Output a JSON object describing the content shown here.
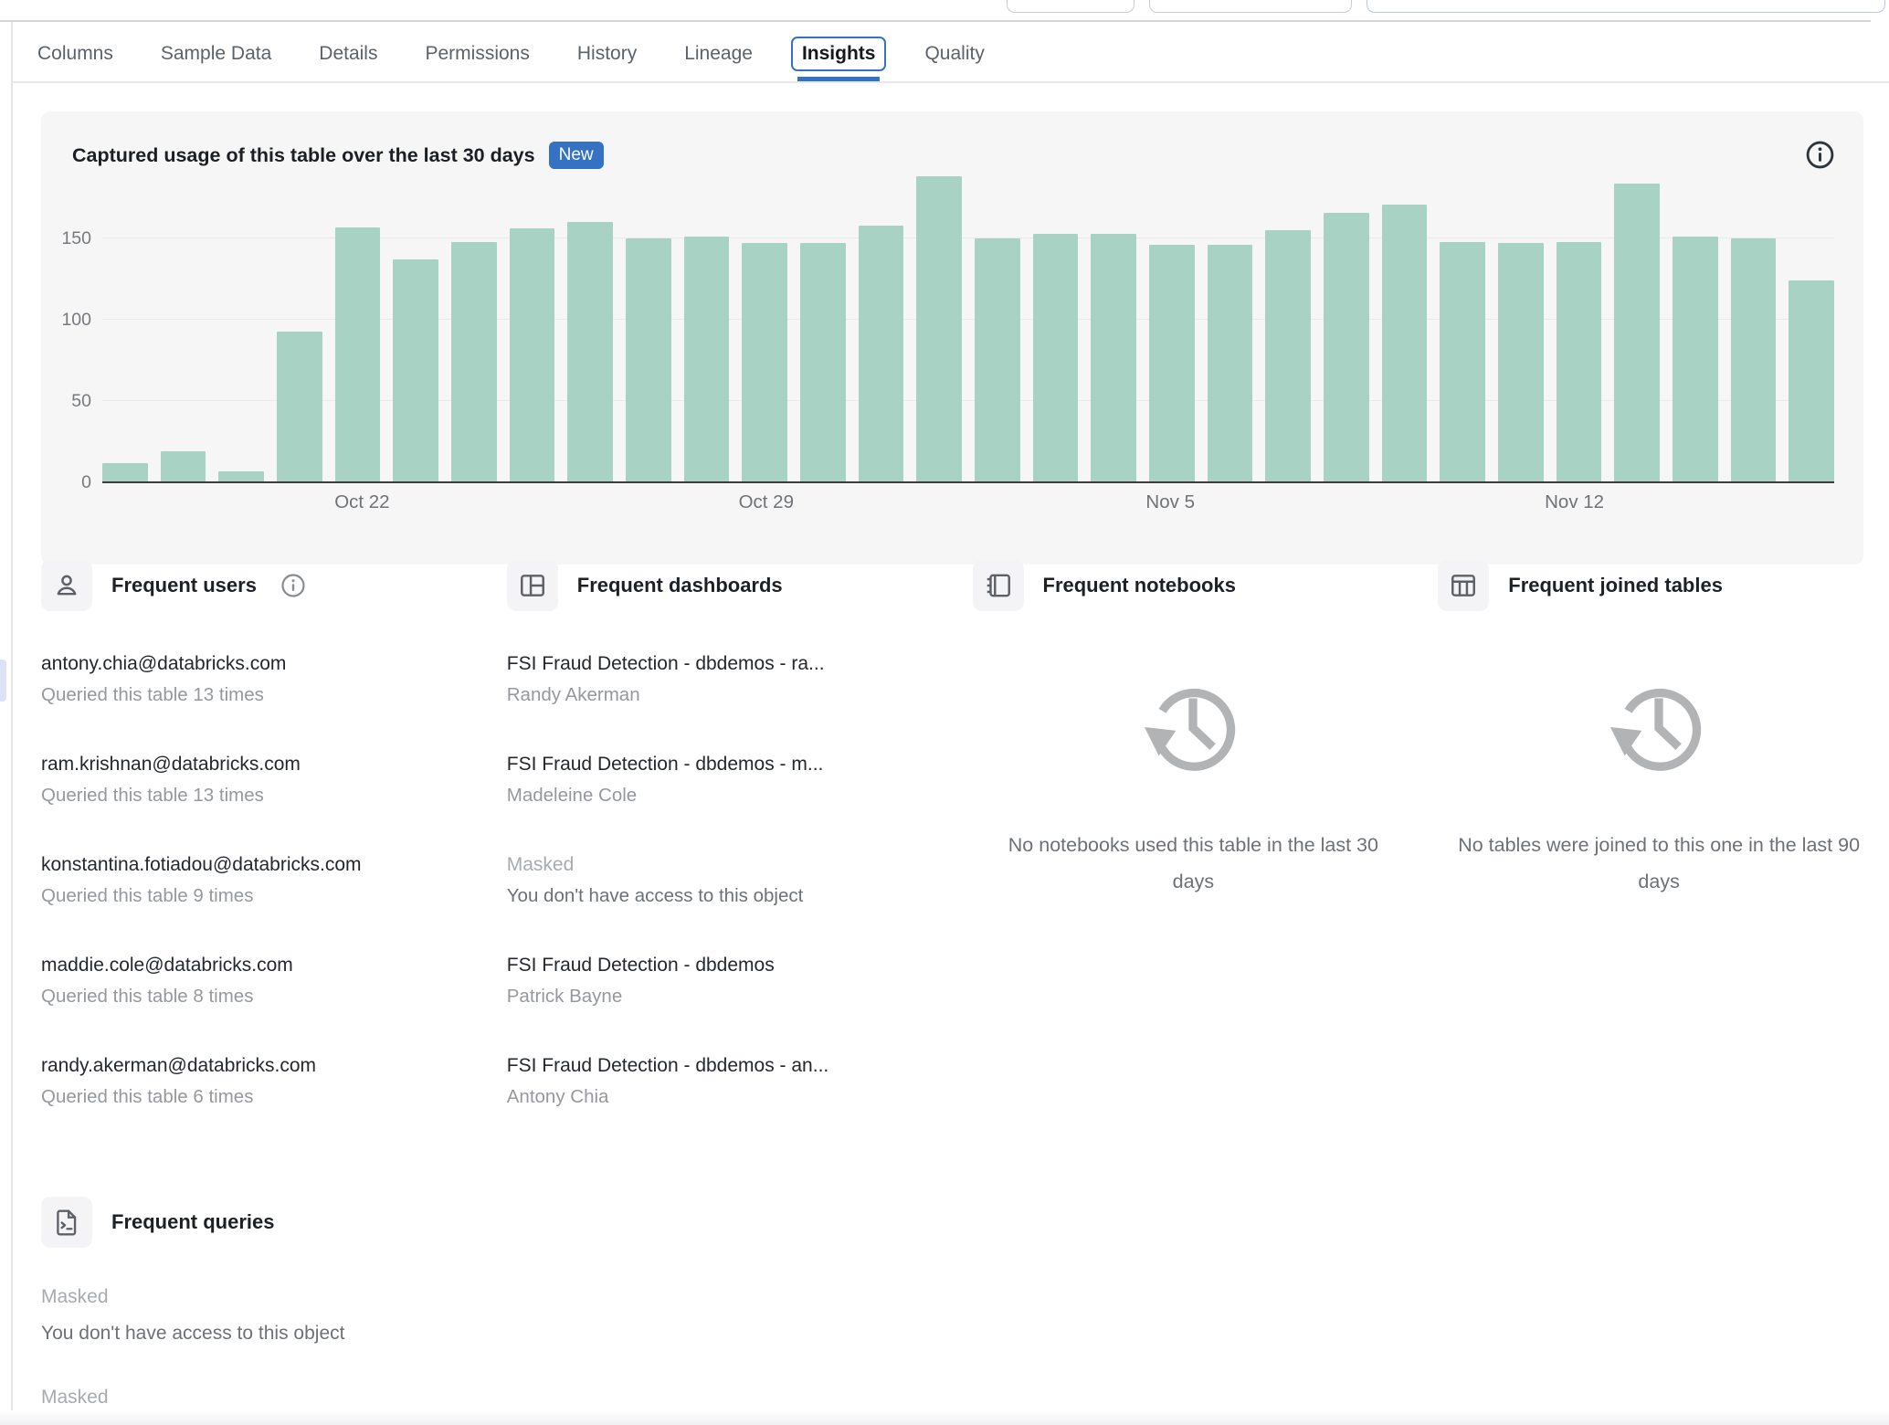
{
  "tabs": {
    "items": [
      {
        "label": "Columns"
      },
      {
        "label": "Sample Data"
      },
      {
        "label": "Details"
      },
      {
        "label": "Permissions"
      },
      {
        "label": "History"
      },
      {
        "label": "Lineage"
      },
      {
        "label": "Insights"
      },
      {
        "label": "Quality"
      }
    ],
    "active": "Insights"
  },
  "usage_panel": {
    "title": "Captured usage of this table over the last 30 days",
    "badge": "New"
  },
  "chart_data": {
    "type": "bar",
    "title": "Captured usage of this table over the last 30 days",
    "x": [
      "Oct 18",
      "Oct 19",
      "Oct 20",
      "Oct 21",
      "Oct 22",
      "Oct 23",
      "Oct 24",
      "Oct 25",
      "Oct 26",
      "Oct 27",
      "Oct 28",
      "Oct 29",
      "Oct 30",
      "Oct 31",
      "Nov 1",
      "Nov 2",
      "Nov 3",
      "Nov 4",
      "Nov 5",
      "Nov 6",
      "Nov 7",
      "Nov 8",
      "Nov 9",
      "Nov 10",
      "Nov 11",
      "Nov 12",
      "Nov 13",
      "Nov 14",
      "Nov 15",
      "Nov 16"
    ],
    "values": [
      12,
      19,
      7,
      93,
      157,
      137,
      148,
      156,
      160,
      150,
      151,
      147,
      147,
      158,
      188,
      150,
      153,
      153,
      146,
      146,
      155,
      166,
      171,
      148,
      147,
      148,
      184,
      151,
      150,
      124
    ],
    "yticks": [
      0,
      50,
      100,
      150
    ],
    "xticks": [
      {
        "index": 4,
        "label": "Oct 22"
      },
      {
        "index": 11,
        "label": "Oct 29"
      },
      {
        "index": 18,
        "label": "Nov 5"
      },
      {
        "index": 25,
        "label": "Nov 12"
      }
    ],
    "ylim": [
      0,
      200
    ],
    "grid": true,
    "legend": false,
    "bar_color": "#a8d2c3"
  },
  "sections": {
    "frequent_users": {
      "title": "Frequent users",
      "items": [
        {
          "email": "antony.chia@databricks.com",
          "detail": "Queried this table 13 times"
        },
        {
          "email": "ram.krishnan@databricks.com",
          "detail": "Queried this table 13 times"
        },
        {
          "email": "konstantina.fotiadou@databricks.com",
          "detail": "Queried this table 9 times"
        },
        {
          "email": "maddie.cole@databricks.com",
          "detail": "Queried this table 8 times"
        },
        {
          "email": "randy.akerman@databricks.com",
          "detail": "Queried this table 6 times"
        }
      ]
    },
    "frequent_dashboards": {
      "title": "Frequent dashboards",
      "items": [
        {
          "name": "FSI Fraud Detection - dbdemos - ra...",
          "owner": "Randy Akerman"
        },
        {
          "name": "FSI Fraud Detection - dbdemos - m...",
          "owner": "Madeleine Cole"
        },
        {
          "name": "Masked",
          "owner": "You don't have access to this object"
        },
        {
          "name": "FSI Fraud Detection - dbdemos",
          "owner": "Patrick Bayne"
        },
        {
          "name": "FSI Fraud Detection - dbdemos - an...",
          "owner": "Antony Chia"
        }
      ]
    },
    "frequent_notebooks": {
      "title": "Frequent notebooks",
      "empty_text": "No notebooks used this table in the last 30 days"
    },
    "frequent_joined_tables": {
      "title": "Frequent joined tables",
      "empty_text": "No tables were joined to this one in the last 90 days"
    },
    "frequent_queries": {
      "title": "Frequent queries",
      "items": [
        {
          "name": "Masked",
          "detail": "You don't have access to this object"
        },
        {
          "name": "Masked"
        }
      ]
    }
  },
  "colors": {
    "accent_blue": "#3672c4",
    "bar_green": "#a8d2c3",
    "panel_bg": "#f6f6f7"
  }
}
